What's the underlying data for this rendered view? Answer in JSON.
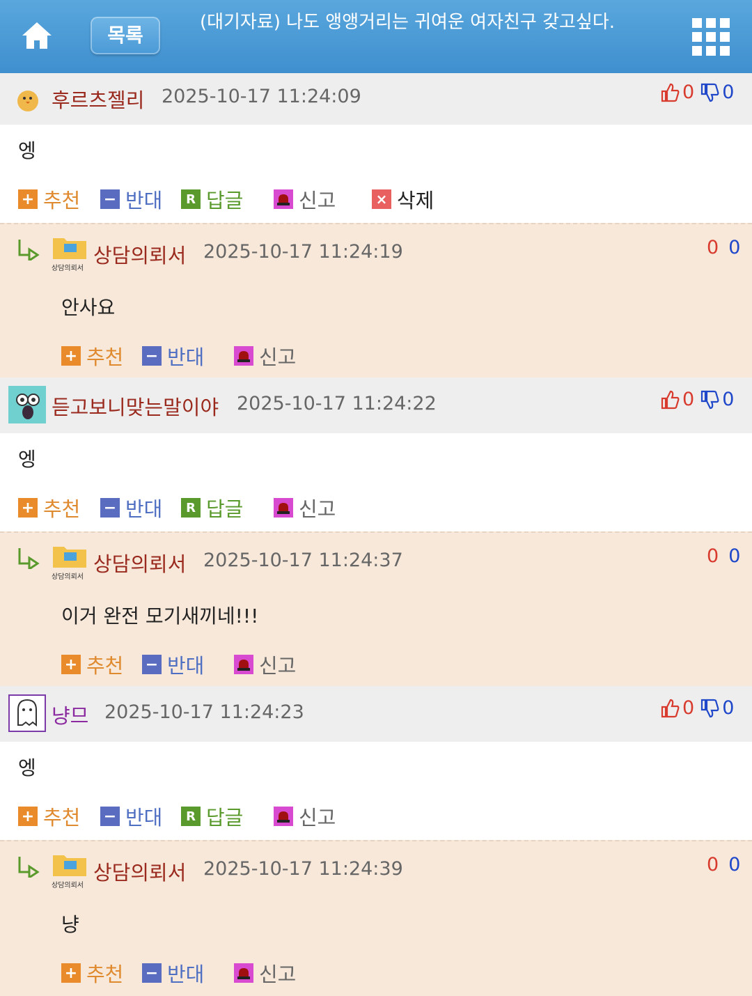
{
  "header": {
    "list_label": "목록",
    "title": "(대기자료) 나도 앵앵거리는 귀여운 여자친구 갖고싶다."
  },
  "actions": {
    "recommend": "추천",
    "oppose": "반대",
    "reply": "답글",
    "report": "신고",
    "delete": "삭제"
  },
  "colors": {
    "header_bg": "#4a99d6",
    "reply_bg": "#f7e8da",
    "nick": "#9b2a1e",
    "nick_purple": "#8b2aa0"
  },
  "comments": [
    {
      "nick": "후르츠젤리",
      "date": "2025-10-17 11:24:09",
      "text": "엥",
      "up": "0",
      "down": "0",
      "avatar": "chick-icon"
    },
    {
      "nick": "상담의뢰서",
      "date": "2025-10-17 11:24:19",
      "text": "안사요",
      "up": "0",
      "down": "0",
      "avatar_caption": "상담의뢰서"
    },
    {
      "nick": "듣고보니맞는말이야",
      "date": "2025-10-17 11:24:22",
      "text": "엥",
      "up": "0",
      "down": "0",
      "avatar": "cartoon-face-icon"
    },
    {
      "nick": "상담의뢰서",
      "date": "2025-10-17 11:24:37",
      "text": "이거 완전 모기새끼네!!!",
      "up": "0",
      "down": "0",
      "avatar_caption": "상담의뢰서"
    },
    {
      "nick": "냥므",
      "date": "2025-10-17 11:24:23",
      "text": "엥",
      "up": "0",
      "down": "0",
      "avatar": "ghost-icon"
    },
    {
      "nick": "상담의뢰서",
      "date": "2025-10-17 11:24:39",
      "text": "냥",
      "up": "0",
      "down": "0",
      "avatar_caption": "상담의뢰서"
    }
  ]
}
